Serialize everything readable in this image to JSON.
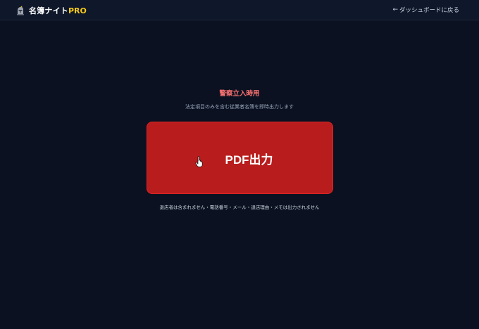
{
  "header": {
    "brand_name": "名簿ナイト",
    "brand_suffix": "PRO",
    "back_arrow": "←",
    "back_label": "ダッシュボードに戻る"
  },
  "main": {
    "section_title": "警察立入時用",
    "section_description": "法定項目のみを含む従業者名簿を即時出力します",
    "pdf_button_label": "PDF出力",
    "note": "退店者は含まれません・電話番号・メール・退店理由・メモは出力されません"
  },
  "icons": {
    "logo": "knight-helmet-icon",
    "cursor": "hand-pointer-icon"
  },
  "colors": {
    "background": "#0b1120",
    "header_background": "#0f172a",
    "brand_accent": "#facc15",
    "title_red": "#f87171",
    "button_red": "#b91c1c"
  }
}
